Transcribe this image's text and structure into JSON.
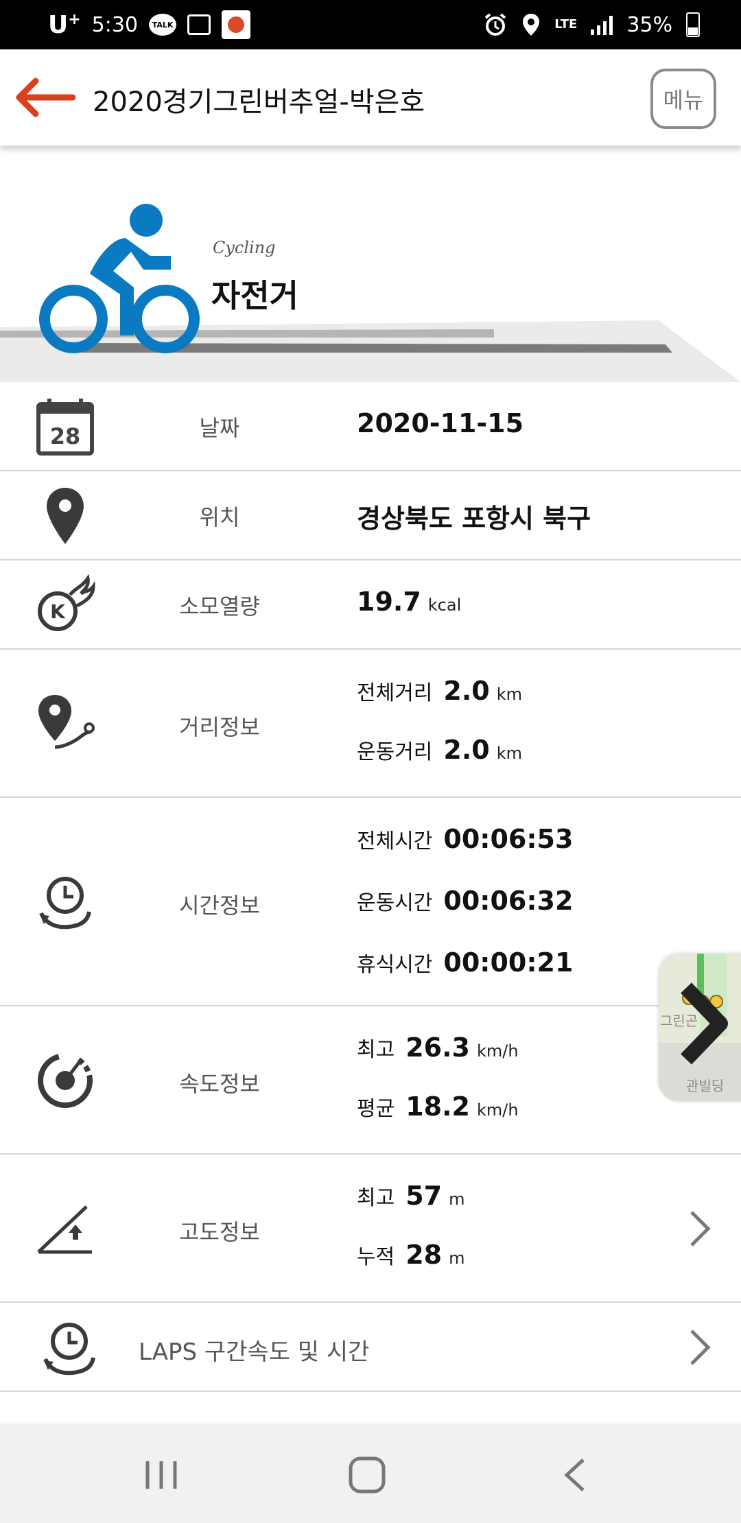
{
  "status_bar": {
    "carrier": "U",
    "carrier_sup": "+",
    "time": "5:30",
    "talk_label": "TALK",
    "network": "LTE",
    "battery": "35%"
  },
  "app_bar": {
    "title": "2020경기그린버추얼-박은호",
    "menu_label": "메뉴"
  },
  "activity": {
    "subtitle": "Cycling",
    "title": "자전거",
    "accent_color": "#0a7ac2"
  },
  "info": {
    "date": {
      "label": "날짜",
      "value": "2020-11-15",
      "calendar_day": "28"
    },
    "location": {
      "label": "위치",
      "value": "경상북도 포항시 북구"
    },
    "calories": {
      "label": "소모열량",
      "value": "19.7",
      "unit": "kcal"
    },
    "distance": {
      "label": "거리정보",
      "total_label": "전체거리",
      "total_value": "2.0",
      "total_unit": "km",
      "exercise_label": "운동거리",
      "exercise_value": "2.0",
      "exercise_unit": "km"
    },
    "time": {
      "label": "시간정보",
      "total_label": "전체시간",
      "total_value": "00:06:53",
      "exercise_label": "운동시간",
      "exercise_value": "00:06:32",
      "rest_label": "휴식시간",
      "rest_value": "00:00:21"
    },
    "speed": {
      "label": "속도정보",
      "max_label": "최고",
      "max_value": "26.3",
      "max_unit": "km/h",
      "avg_label": "평균",
      "avg_value": "18.2",
      "avg_unit": "km/h"
    },
    "altitude": {
      "label": "고도정보",
      "max_label": "최고",
      "max_value": "57",
      "max_unit": "m",
      "cum_label": "누적",
      "cum_value": "28",
      "cum_unit": "m"
    },
    "laps": {
      "label": "LAPS 구간속도 및 시간"
    }
  },
  "map_thumbnail": {
    "building_text": "관빌딩",
    "text2": "그린곤"
  }
}
